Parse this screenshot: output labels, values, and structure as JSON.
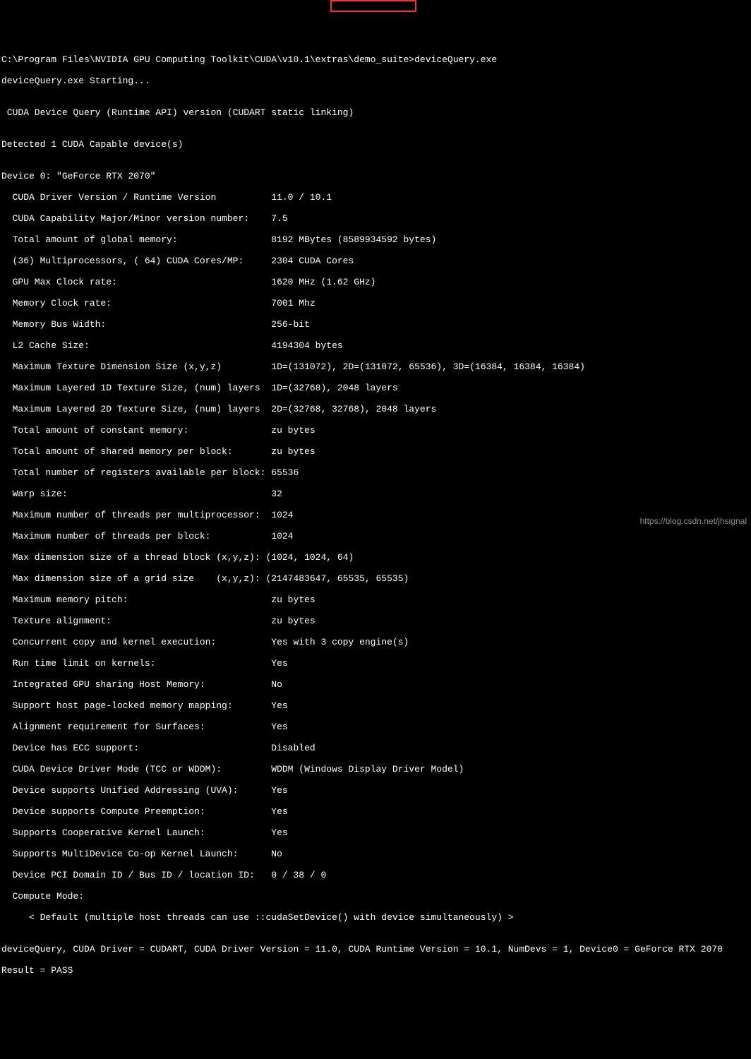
{
  "prompt": {
    "path": "C:\\Program Files\\NVIDIA GPU Computing Toolkit\\CUDA\\v10.1\\extras\\demo_suite>",
    "command": "deviceQuery.exe"
  },
  "startup": "deviceQuery.exe Starting...",
  "blank1": "",
  "header_api": " CUDA Device Query (Runtime API) version (CUDART static linking)",
  "blank2": "",
  "detected": "Detected 1 CUDA Capable device(s)",
  "blank3": "",
  "device_header": "Device 0: \"GeForce RTX 2070\"",
  "rows": [
    "  CUDA Driver Version / Runtime Version          11.0 / 10.1",
    "  CUDA Capability Major/Minor version number:    7.5",
    "  Total amount of global memory:                 8192 MBytes (8589934592 bytes)",
    "  (36) Multiprocessors, ( 64) CUDA Cores/MP:     2304 CUDA Cores",
    "  GPU Max Clock rate:                            1620 MHz (1.62 GHz)",
    "  Memory Clock rate:                             7001 Mhz",
    "  Memory Bus Width:                              256-bit",
    "  L2 Cache Size:                                 4194304 bytes",
    "  Maximum Texture Dimension Size (x,y,z)         1D=(131072), 2D=(131072, 65536), 3D=(16384, 16384, 16384)",
    "  Maximum Layered 1D Texture Size, (num) layers  1D=(32768), 2048 layers",
    "  Maximum Layered 2D Texture Size, (num) layers  2D=(32768, 32768), 2048 layers",
    "  Total amount of constant memory:               zu bytes",
    "  Total amount of shared memory per block:       zu bytes",
    "  Total number of registers available per block: 65536",
    "  Warp size:                                     32",
    "  Maximum number of threads per multiprocessor:  1024",
    "  Maximum number of threads per block:           1024",
    "  Max dimension size of a thread block (x,y,z): (1024, 1024, 64)",
    "  Max dimension size of a grid size    (x,y,z): (2147483647, 65535, 65535)",
    "  Maximum memory pitch:                          zu bytes",
    "  Texture alignment:                             zu bytes",
    "  Concurrent copy and kernel execution:          Yes with 3 copy engine(s)",
    "  Run time limit on kernels:                     Yes",
    "  Integrated GPU sharing Host Memory:            No",
    "  Support host page-locked memory mapping:       Yes",
    "  Alignment requirement for Surfaces:            Yes",
    "  Device has ECC support:                        Disabled",
    "  CUDA Device Driver Mode (TCC or WDDM):         WDDM (Windows Display Driver Model)",
    "  Device supports Unified Addressing (UVA):      Yes",
    "  Device supports Compute Preemption:            Yes",
    "  Supports Cooperative Kernel Launch:            Yes",
    "  Supports MultiDevice Co-op Kernel Launch:      No",
    "  Device PCI Domain ID / Bus ID / location ID:   0 / 38 / 0",
    "  Compute Mode:",
    "     < Default (multiple host threads can use ::cudaSetDevice() with device simultaneously) >"
  ],
  "blank4": "",
  "summary": "deviceQuery, CUDA Driver = CUDART, CUDA Driver Version = 11.0, CUDA Runtime Version = 10.1, NumDevs = 1, Device0 = GeForce RTX 2070",
  "result": "Result = PASS",
  "watermark": "https://blog.csdn.net/jhsignal"
}
